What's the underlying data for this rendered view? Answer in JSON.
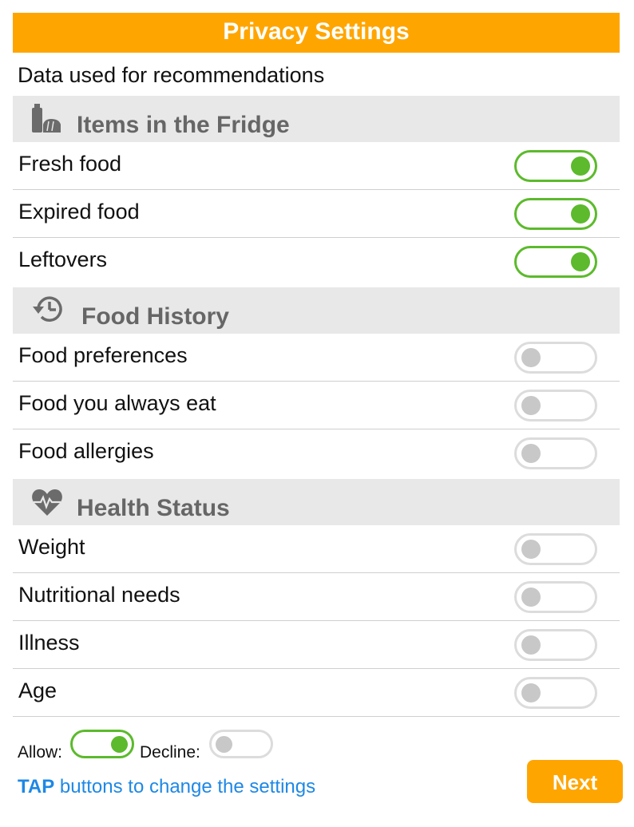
{
  "header": {
    "title": "Privacy Settings"
  },
  "subtitle": "Data used for recommendations",
  "sections": [
    {
      "title": "Items in the Fridge",
      "icon": "fridge-items-icon",
      "items": [
        {
          "label": "Fresh food",
          "enabled": true
        },
        {
          "label": "Expired food",
          "enabled": true
        },
        {
          "label": "Leftovers",
          "enabled": true
        }
      ]
    },
    {
      "title": "Food History",
      "icon": "history-icon",
      "items": [
        {
          "label": "Food preferences",
          "enabled": false
        },
        {
          "label": "Food you always eat",
          "enabled": false
        },
        {
          "label": "Food allergies",
          "enabled": false
        }
      ]
    },
    {
      "title": "Health Status",
      "icon": "heart-pulse-icon",
      "items": [
        {
          "label": "Weight",
          "enabled": false
        },
        {
          "label": "Nutritional needs",
          "enabled": false
        },
        {
          "label": "Illness",
          "enabled": false
        },
        {
          "label": "Age",
          "enabled": false
        }
      ]
    }
  ],
  "legend": {
    "allow_label": "Allow:",
    "decline_label": "Decline:"
  },
  "hint": {
    "tap": "TAP",
    "rest": " buttons to change the settings"
  },
  "next_label": "Next",
  "colors": {
    "accent": "#FFA500",
    "toggle_on": "#5CBA2C",
    "toggle_off": "#C8C8C8",
    "section_bg": "#E8E8E8",
    "hint": "#1E88E5"
  }
}
